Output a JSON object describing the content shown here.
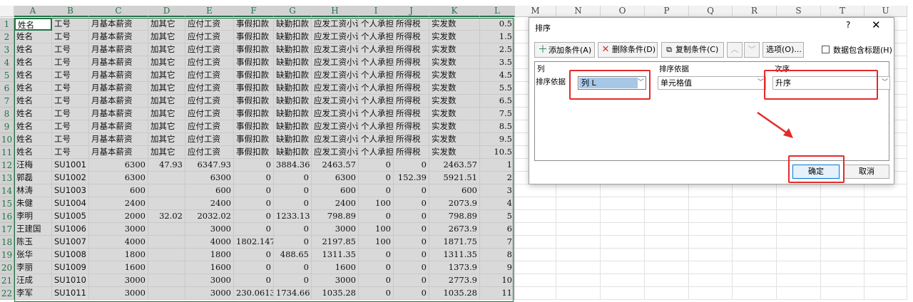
{
  "columns": [
    "A",
    "B",
    "C",
    "D",
    "E",
    "F",
    "G",
    "H",
    "I",
    "J",
    "K",
    "L",
    "M",
    "N",
    "O",
    "P",
    "Q",
    "R",
    "S",
    "T",
    "U"
  ],
  "rows": [
    [
      "姓名",
      "工号",
      "月基本薪资",
      "加其它",
      "应付工资",
      "事假扣款",
      "缺勤扣款",
      "应发工资小计",
      "个人承担",
      "所得税",
      "实发数",
      "0.5"
    ],
    [
      "姓名",
      "工号",
      "月基本薪资",
      "加其它",
      "应付工资",
      "事假扣款",
      "缺勤扣款",
      "应发工资小计",
      "个人承担",
      "所得税",
      "实发数",
      "1.5"
    ],
    [
      "姓名",
      "工号",
      "月基本薪资",
      "加其它",
      "应付工资",
      "事假扣款",
      "缺勤扣款",
      "应发工资小计",
      "个人承担",
      "所得税",
      "实发数",
      "2.5"
    ],
    [
      "姓名",
      "工号",
      "月基本薪资",
      "加其它",
      "应付工资",
      "事假扣款",
      "缺勤扣款",
      "应发工资小计",
      "个人承担",
      "所得税",
      "实发数",
      "3.5"
    ],
    [
      "姓名",
      "工号",
      "月基本薪资",
      "加其它",
      "应付工资",
      "事假扣款",
      "缺勤扣款",
      "应发工资小计",
      "个人承担",
      "所得税",
      "实发数",
      "4.5"
    ],
    [
      "姓名",
      "工号",
      "月基本薪资",
      "加其它",
      "应付工资",
      "事假扣款",
      "缺勤扣款",
      "应发工资小计",
      "个人承担",
      "所得税",
      "实发数",
      "5.5"
    ],
    [
      "姓名",
      "工号",
      "月基本薪资",
      "加其它",
      "应付工资",
      "事假扣款",
      "缺勤扣款",
      "应发工资小计",
      "个人承担",
      "所得税",
      "实发数",
      "6.5"
    ],
    [
      "姓名",
      "工号",
      "月基本薪资",
      "加其它",
      "应付工资",
      "事假扣款",
      "缺勤扣款",
      "应发工资小计",
      "个人承担",
      "所得税",
      "实发数",
      "7.5"
    ],
    [
      "姓名",
      "工号",
      "月基本薪资",
      "加其它",
      "应付工资",
      "事假扣款",
      "缺勤扣款",
      "应发工资小计",
      "个人承担",
      "所得税",
      "实发数",
      "8.5"
    ],
    [
      "姓名",
      "工号",
      "月基本薪资",
      "加其它",
      "应付工资",
      "事假扣款",
      "缺勤扣款",
      "应发工资小计",
      "个人承担",
      "所得税",
      "实发数",
      "9.5"
    ],
    [
      "姓名",
      "工号",
      "月基本薪资",
      "加其它",
      "应付工资",
      "事假扣款",
      "缺勤扣款",
      "应发工资小计",
      "个人承担",
      "所得税",
      "实发数",
      "10.5"
    ],
    [
      "汪梅",
      "SU1001",
      "6300",
      "47.93",
      "6347.93",
      "0",
      "3884.36",
      "2463.57",
      "0",
      "0",
      "2463.57",
      "1"
    ],
    [
      "郭磊",
      "SU1002",
      "6300",
      "",
      "6300",
      "0",
      "0",
      "6300",
      "0",
      "152.39",
      "5921.51",
      "2"
    ],
    [
      "林涛",
      "SU1003",
      "600",
      "",
      "600",
      "0",
      "0",
      "600",
      "0",
      "0",
      "600",
      "3"
    ],
    [
      "朱健",
      "SU1004",
      "2400",
      "",
      "2400",
      "0",
      "0",
      "2400",
      "100",
      "0",
      "2073.9",
      "4"
    ],
    [
      "李明",
      "SU1005",
      "2000",
      "32.02",
      "2032.02",
      "0",
      "1233.13",
      "798.89",
      "0",
      "0",
      "798.89",
      "5"
    ],
    [
      "王建国",
      "SU1006",
      "3000",
      "",
      "3000",
      "0",
      "0",
      "3000",
      "100",
      "0",
      "2673.9",
      "6"
    ],
    [
      "陈玉",
      "SU1007",
      "4000",
      "",
      "4000",
      "1802.147",
      "0",
      "2197.85",
      "100",
      "0",
      "1871.75",
      "7"
    ],
    [
      "张华",
      "SU1008",
      "1800",
      "",
      "1800",
      "0",
      "488.65",
      "1311.35",
      "0",
      "0",
      "1311.35",
      "8"
    ],
    [
      "李丽",
      "SU1009",
      "1600",
      "",
      "1600",
      "0",
      "0",
      "1600",
      "0",
      "0",
      "1373.9",
      "9"
    ],
    [
      "汪成",
      "SU1010",
      "3000",
      "",
      "3000",
      "0",
      "0",
      "3000",
      "0",
      "0",
      "2773.9",
      "10"
    ],
    [
      "李军",
      "SU1011",
      "3000",
      "",
      "3000",
      "230.0613",
      "1734.66",
      "1035.28",
      "0",
      "0",
      "1035.28",
      "11"
    ]
  ],
  "dialog": {
    "title": "排序",
    "help": "?",
    "close": "✕",
    "add_label": "添加条件(A)",
    "delete_label": "删除条件(D)",
    "copy_label": "复制条件(C)",
    "up_label": "︿",
    "down_label": "﹀",
    "options_label": "选项(O)...",
    "header_checkbox_label": "数据包含标题(H)",
    "col_header": "列",
    "sorton_header": "排序依据",
    "order_header": "次序",
    "row_label": "排序依据",
    "column_value": "列 L",
    "sorton_value": "单元格值",
    "order_value": "升序",
    "ok_label": "确定",
    "cancel_label": "取消"
  },
  "colors": {
    "annotation": "#e52a2a",
    "selection": "#217346"
  }
}
